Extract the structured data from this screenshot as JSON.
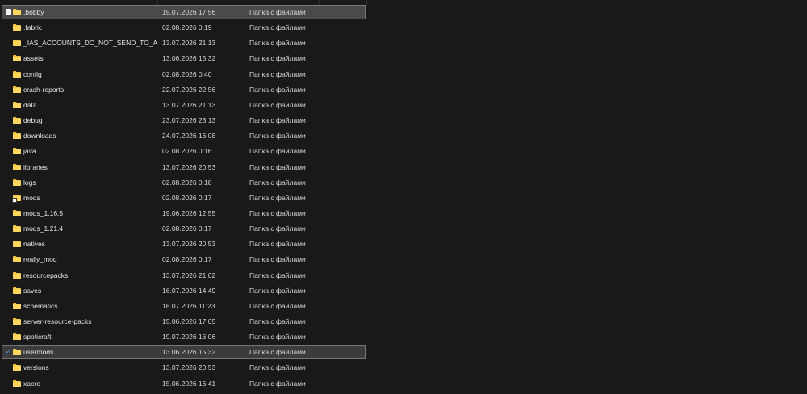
{
  "file_type_label": "Папка с файлами",
  "icons": {
    "folder": "folder-icon",
    "checkbox": "checkbox-icon",
    "check": "check-icon",
    "overlay": "shortcut-overlay-icon"
  },
  "colors": {
    "background": "#191919",
    "folder": "#f5c542",
    "selected": "#4a4a4a",
    "check": "#4da3ff"
  },
  "rows": [
    {
      "name": ".bobby",
      "date": "19.07.2026 17:56",
      "type": "Папка с файлами",
      "state": "selected"
    },
    {
      "name": ".fabric",
      "date": "02.08.2026 0:19",
      "type": "Папка с файлами"
    },
    {
      "name": "_IAS_ACCOUNTS_DO_NOT_SEND_TO_ANYONE",
      "date": "13.07.2026 21:13",
      "type": "Папка с файлами"
    },
    {
      "name": "assets",
      "date": "13.06.2026 15:32",
      "type": "Папка с файлами"
    },
    {
      "name": "config",
      "date": "02.08.2026 0:40",
      "type": "Папка с файлами"
    },
    {
      "name": "crash-reports",
      "date": "22.07.2026 22:56",
      "type": "Папка с файлами"
    },
    {
      "name": "data",
      "date": "13.07.2026 21:13",
      "type": "Папка с файлами"
    },
    {
      "name": "debug",
      "date": "23.07.2026 23:13",
      "type": "Папка с файлами"
    },
    {
      "name": "downloads",
      "date": "24.07.2026 16:08",
      "type": "Папка с файлами"
    },
    {
      "name": "java",
      "date": "02.08.2026 0:16",
      "type": "Папка с файлами"
    },
    {
      "name": "libraries",
      "date": "13.07.2026 20:53",
      "type": "Папка с файлами"
    },
    {
      "name": "logs",
      "date": "02.08.2026 0:18",
      "type": "Папка с файлами"
    },
    {
      "name": "mods",
      "date": "02.08.2026 0:17",
      "type": "Папка с файлами",
      "overlay": true
    },
    {
      "name": "mods_1.16.5",
      "date": "19.06.2026 12:55",
      "type": "Папка с файлами"
    },
    {
      "name": "mods_1.21.4",
      "date": "02.08.2026 0:17",
      "type": "Папка с файлами"
    },
    {
      "name": "natives",
      "date": "13.07.2026 20:53",
      "type": "Папка с файлами"
    },
    {
      "name": "really_mod",
      "date": "02.08.2026 0:17",
      "type": "Папка с файлами"
    },
    {
      "name": "resourcepacks",
      "date": "13.07.2026 21:02",
      "type": "Папка с файлами"
    },
    {
      "name": "saves",
      "date": "16.07.2026 14:49",
      "type": "Папка с файлами"
    },
    {
      "name": "schematics",
      "date": "18.07.2026 11:23",
      "type": "Папка с файлами"
    },
    {
      "name": "server-resource-packs",
      "date": "15.06.2026 17:05",
      "type": "Папка с файлами"
    },
    {
      "name": "spoticraft",
      "date": "19.07.2026 16:06",
      "type": "Папка с файлами"
    },
    {
      "name": "usermods",
      "date": "13.06.2026 15:32",
      "type": "Папка с файлами",
      "state": "checked"
    },
    {
      "name": "versions",
      "date": "13.07.2026 20:53",
      "type": "Папка с файлами"
    },
    {
      "name": "xaero",
      "date": "15.06.2026 16:41",
      "type": "Папка с файлами"
    }
  ]
}
